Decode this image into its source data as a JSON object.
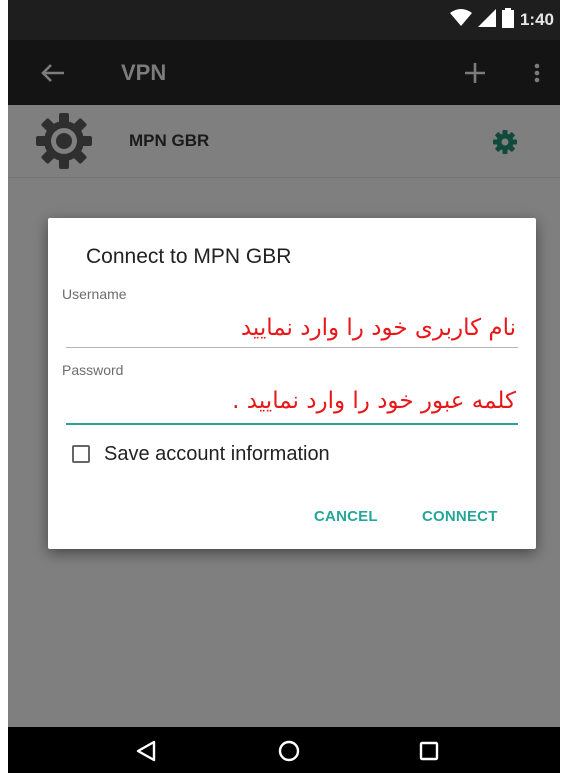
{
  "status_bar": {
    "time": "1:40",
    "icons": [
      "wifi-icon",
      "signal-icon",
      "battery-icon"
    ]
  },
  "toolbar": {
    "title": "VPN",
    "back_icon": "back-arrow-icon",
    "add_icon": "plus-icon",
    "more_icon": "overflow-menu-icon"
  },
  "vpn_list": {
    "items": [
      {
        "name": "MPN GBR",
        "icon": "vpn-gear-icon",
        "action_icon": "settings-gear-icon"
      }
    ]
  },
  "dialog": {
    "title": "Connect to MPN GBR",
    "username": {
      "label": "Username",
      "value": "نام کاربری خود را وارد نمایید"
    },
    "password": {
      "label": "Password",
      "value": "کلمه عبور خود را وارد نمایید ."
    },
    "save_account": {
      "label": "Save account information",
      "checked": false
    },
    "cancel_label": "CANCEL",
    "connect_label": "CONNECT"
  },
  "nav_bar": {
    "icons": [
      "back-triangle-icon",
      "home-circle-icon",
      "recents-square-icon"
    ]
  },
  "colors": {
    "accent": "#26a69a",
    "input_text": "#e8181a",
    "scrim": "#7f7f7f",
    "toolbar": "#141414"
  }
}
